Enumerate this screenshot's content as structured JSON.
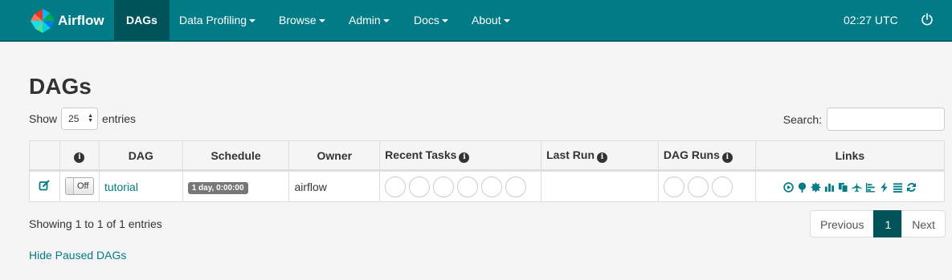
{
  "navbar": {
    "brand": "Airflow",
    "items": [
      {
        "label": "DAGs",
        "active": true
      },
      {
        "label": "Data Profiling",
        "dropdown": true
      },
      {
        "label": "Browse",
        "dropdown": true
      },
      {
        "label": "Admin",
        "dropdown": true
      },
      {
        "label": "Docs",
        "dropdown": true
      },
      {
        "label": "About",
        "dropdown": true
      }
    ],
    "time": "02:27 UTC",
    "power_icon": "power-icon"
  },
  "page": {
    "title": "DAGs",
    "show_label": "Show",
    "entries_value": "25",
    "entries_label": "entries",
    "search_label": "Search:",
    "search_value": ""
  },
  "table": {
    "headers": {
      "info": "i",
      "dag": "DAG",
      "schedule": "Schedule",
      "owner": "Owner",
      "recent_tasks": "Recent Tasks",
      "last_run": "Last Run",
      "dag_runs": "DAG Runs",
      "links": "Links"
    },
    "rows": [
      {
        "toggle": "Off",
        "dag": "tutorial",
        "schedule": "1 day, 0:00:00",
        "owner": "airflow",
        "recent_tasks_circles": 6,
        "last_run": "",
        "dag_runs_circles": 3,
        "links": [
          "trigger-dag-icon",
          "tree-view-icon",
          "graph-view-icon",
          "task-duration-icon",
          "task-tries-icon",
          "landing-times-icon",
          "gantt-icon",
          "code-icon",
          "logs-icon",
          "refresh-icon"
        ]
      }
    ]
  },
  "footer": {
    "showing": "Showing 1 to 1 of 1 entries",
    "previous": "Previous",
    "current_page": "1",
    "next": "Next",
    "hide_paused": "Hide Paused DAGs"
  },
  "colors": {
    "navbar": "#017b86",
    "navbar_active": "#01535a",
    "link": "#017b86"
  }
}
